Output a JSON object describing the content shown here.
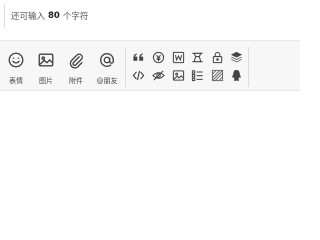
{
  "counter": {
    "prefix": "还可输入",
    "count": "80",
    "suffix": "个字符"
  },
  "toolbar": {
    "main_tools": [
      {
        "label": "表情",
        "icon": "smiley-icon"
      },
      {
        "label": "图片",
        "icon": "image-icon"
      },
      {
        "label": "附件",
        "icon": "paperclip-icon"
      },
      {
        "label": "@朋友",
        "icon": "at-icon"
      }
    ],
    "extra_tools_row1": [
      "quote-icon",
      "reward-icon",
      "word-doc-icon",
      "hide-content-icon",
      "lock-icon",
      "layers-icon"
    ],
    "extra_tools_row2": [
      "code-icon",
      "hidden-eye-icon",
      "image-icon",
      "list-icon",
      "stripes-icon",
      "qq-icon"
    ]
  }
}
